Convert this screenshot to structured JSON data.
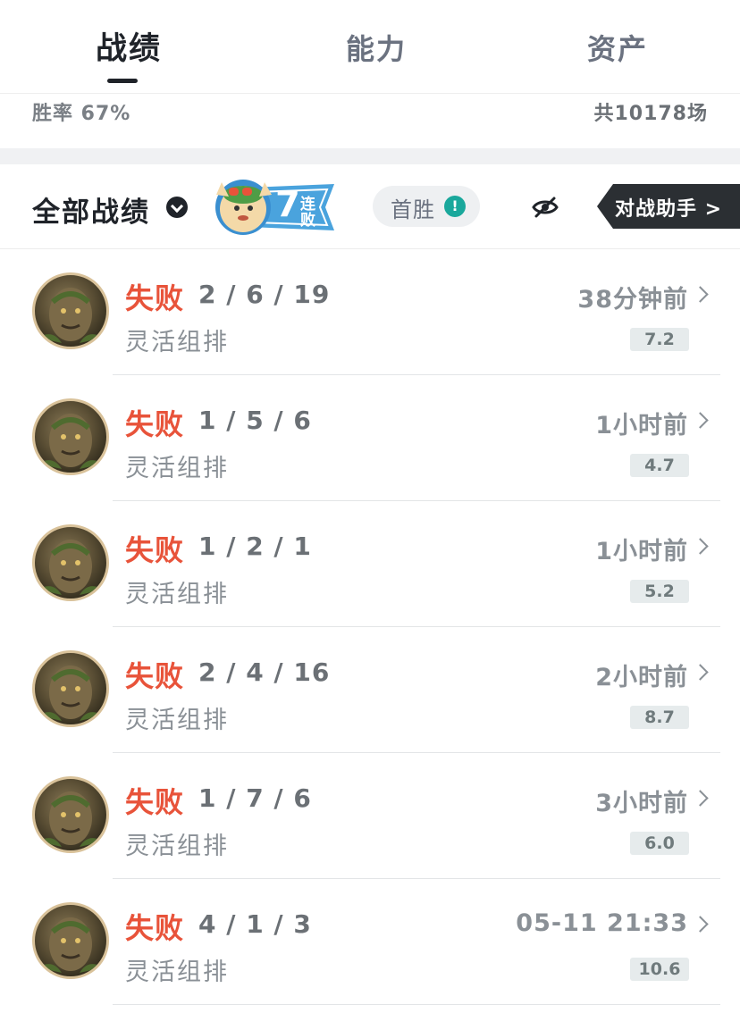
{
  "tabs": [
    {
      "label": "战绩",
      "active": true
    },
    {
      "label": "能力",
      "active": false
    },
    {
      "label": "资产",
      "active": false
    }
  ],
  "summary": {
    "win_rate": "胜率 67%",
    "total_games": "共10178场"
  },
  "filter": {
    "all_records_label": "全部战绩",
    "streak_count": "7",
    "streak_label_top": "连",
    "streak_label_bottom": "败",
    "first_win_label": "首胜",
    "info_icon_glyph": "!",
    "assistant_label": "对战助手 >"
  },
  "colors": {
    "loss": "#e8533a",
    "accent": "#1aa89c",
    "badge_blue": "#4aa3dd"
  },
  "matches": [
    {
      "result": "失败",
      "kda": "2 / 6 / 19",
      "mode": "灵活组排",
      "time": "38分钟前",
      "score": "7.2"
    },
    {
      "result": "失败",
      "kda": "1 / 5 / 6",
      "mode": "灵活组排",
      "time": "1小时前",
      "score": "4.7"
    },
    {
      "result": "失败",
      "kda": "1 / 2 / 1",
      "mode": "灵活组排",
      "time": "1小时前",
      "score": "5.2"
    },
    {
      "result": "失败",
      "kda": "2 / 4 / 16",
      "mode": "灵活组排",
      "time": "2小时前",
      "score": "8.7"
    },
    {
      "result": "失败",
      "kda": "1 / 7 / 6",
      "mode": "灵活组排",
      "time": "3小时前",
      "score": "6.0"
    },
    {
      "result": "失败",
      "kda": "4 / 1 / 3",
      "mode": "灵活组排",
      "time": "05-11 21:33",
      "score": "10.6"
    }
  ]
}
